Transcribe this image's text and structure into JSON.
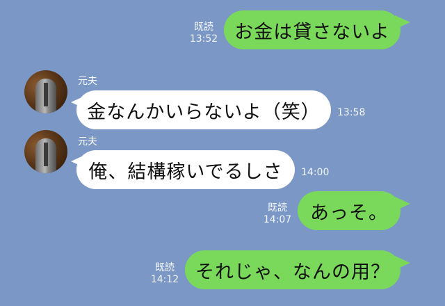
{
  "messages": [
    {
      "text": "お金は貸さないよ",
      "read": "既読",
      "time": "13:52"
    },
    {
      "sender": "元夫",
      "text": "金なんかいらないよ（笑）",
      "time": "13:58"
    },
    {
      "sender": "元夫",
      "text": "俺、結構稼いでるしさ",
      "time": "14:00"
    },
    {
      "text": "あっそ。",
      "read": "既読",
      "time": "14:07"
    },
    {
      "text": "それじゃ、なんの用？",
      "read": "既読",
      "time": "14:12"
    }
  ]
}
